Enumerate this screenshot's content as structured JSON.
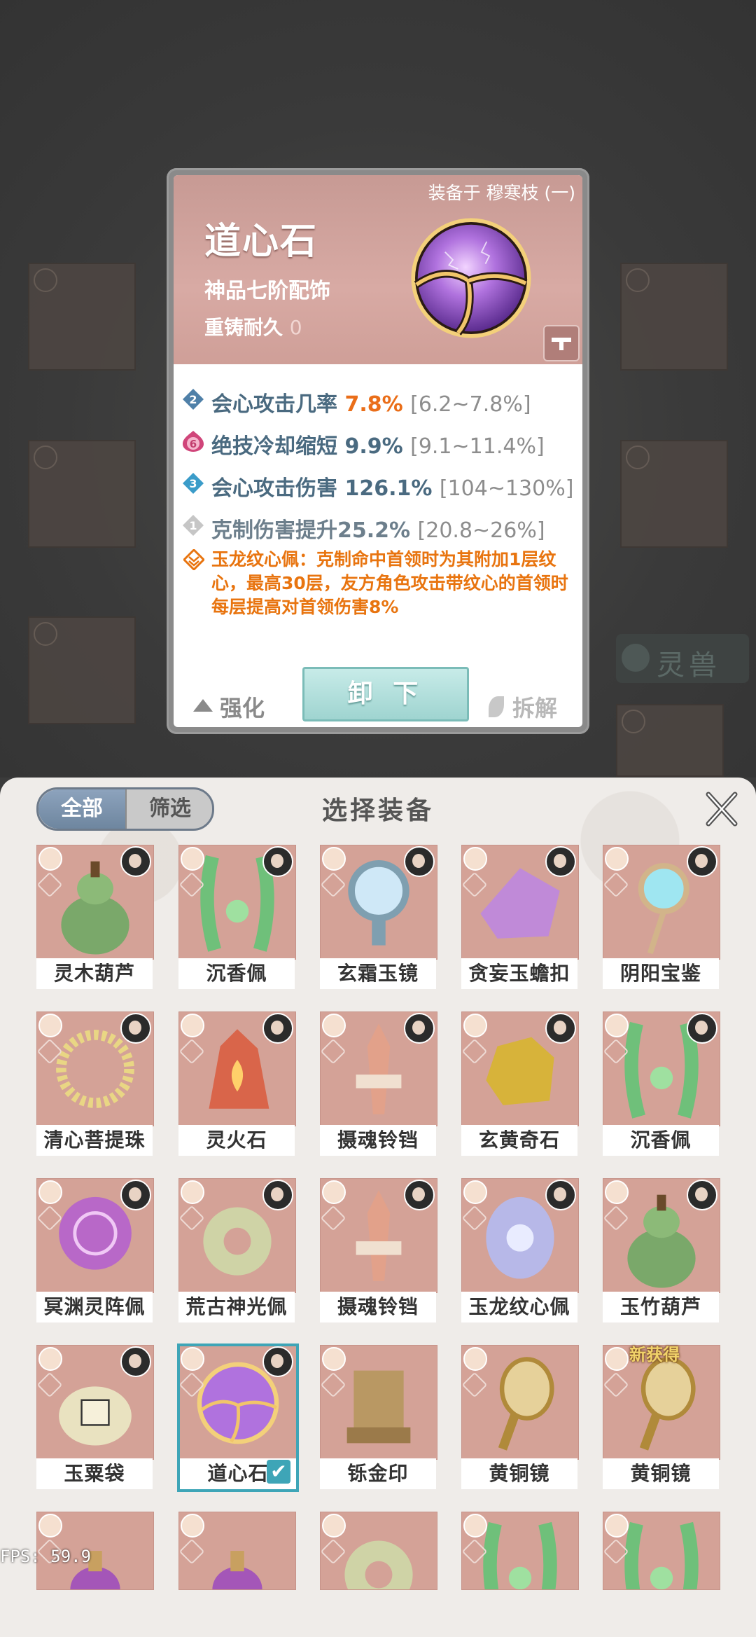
{
  "background": {
    "beast_tab_label": "灵兽"
  },
  "detail": {
    "equipped_on": "装备于 穆寒枝 (一)",
    "name": "道心石",
    "grade": "神品七阶配饰",
    "recast_label": "重铸耐久",
    "recast_value": "0",
    "stats": [
      {
        "badge": "2",
        "badge_color": "#4f80a8",
        "label": "会心攻击几率",
        "value": "7.8%",
        "range": "[6.2~7.8%]",
        "value_highlight": true
      },
      {
        "badge": "6",
        "badge_color": "#d0457a",
        "label": "绝技冷却缩短",
        "value": "9.9%",
        "range": "[9.1~11.4%]",
        "value_highlight": false
      },
      {
        "badge": "3",
        "badge_color": "#3b9cc9",
        "label": "会心攻击伤害",
        "value": "126.1%",
        "range": "[104~130%]",
        "value_highlight": false
      },
      {
        "badge": "1",
        "badge_color": "#b8b8b8",
        "label": "克制伤害提升",
        "value": "25.2%",
        "range": "[20.8~26%]",
        "value_highlight": false
      }
    ],
    "set_bonus": "玉龙纹心佩：克制命中首领时为其附加1层纹心，最高30层，友方角色攻击带纹心的首领时每层提高对首领伤害8%",
    "actions": {
      "upgrade": "强化",
      "unequip": "卸 下",
      "salvage": "拆解"
    }
  },
  "panel": {
    "filter_all": "全部",
    "filter_screen": "筛选",
    "title": "选择装备",
    "new_tag": "新获得",
    "items": [
      {
        "name": "灵木葫芦",
        "art": "gourd-green"
      },
      {
        "name": "沉香佩",
        "art": "jade-pendant"
      },
      {
        "name": "玄霜玉镜",
        "art": "mirror-blue"
      },
      {
        "name": "贪妄玉蟾扣",
        "art": "crystal-toad"
      },
      {
        "name": "阴阳宝鉴",
        "art": "mirror-staff"
      },
      {
        "name": "清心菩提珠",
        "art": "beads"
      },
      {
        "name": "灵火石",
        "art": "fire-stone"
      },
      {
        "name": "摄魂铃铛",
        "art": "dagger-bell"
      },
      {
        "name": "玄黄奇石",
        "art": "gold-stone"
      },
      {
        "name": "沉香佩",
        "art": "jade-pendant"
      },
      {
        "name": "冥渊灵阵佩",
        "art": "purple-disc"
      },
      {
        "name": "荒古神光佩",
        "art": "bronze-pendant"
      },
      {
        "name": "摄魂铃铛",
        "art": "dagger-bell"
      },
      {
        "name": "玉龙纹心佩",
        "art": "dragon-pendant"
      },
      {
        "name": "玉竹葫芦",
        "art": "gourd-green"
      },
      {
        "name": "玉粟袋",
        "art": "seed-bag"
      },
      {
        "name": "道心石",
        "art": "purple-orb"
      },
      {
        "name": "铄金印",
        "art": "gold-seal"
      },
      {
        "name": "黄铜镜",
        "art": "brass-mirror"
      },
      {
        "name": "黄铜镜",
        "art": "brass-mirror"
      },
      {
        "name": "",
        "art": "purple-vase"
      },
      {
        "name": "",
        "art": "purple-vase"
      },
      {
        "name": "",
        "art": "bronze-pendant"
      },
      {
        "name": "",
        "art": "jade-pendant"
      },
      {
        "name": "",
        "art": "jade-pendant"
      }
    ]
  },
  "fps": "FPS: 59.9"
}
